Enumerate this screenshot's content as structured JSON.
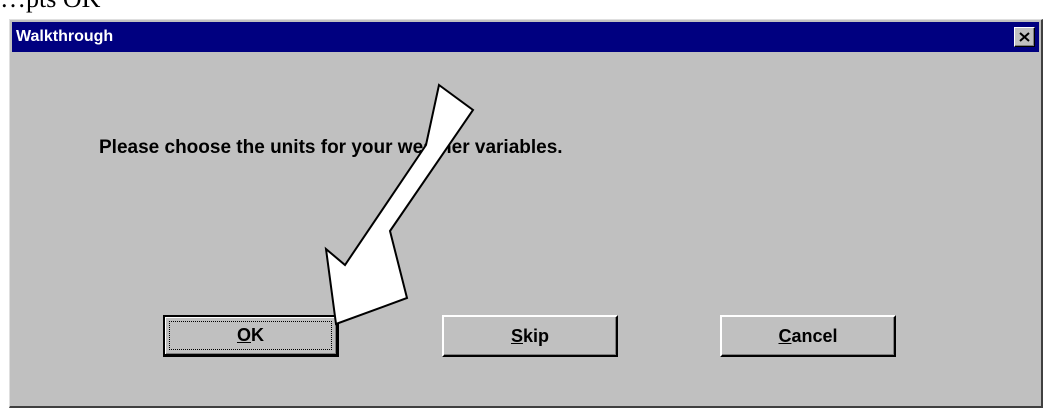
{
  "document": {
    "fragment_text": "…pts OK"
  },
  "dialog": {
    "title": "Walkthrough",
    "close_label": "close",
    "message": "Please choose the units for your weather variables.",
    "buttons": {
      "ok": {
        "mnemonic": "O",
        "rest": "K"
      },
      "skip": {
        "mnemonic": "S",
        "rest": "kip"
      },
      "cancel": {
        "mnemonic": "C",
        "rest": "ancel"
      }
    }
  },
  "annotation": {
    "type": "pointer-arrow",
    "icon": "arrow-icon",
    "target": "ok-button"
  },
  "colors": {
    "titlebar": "#000080",
    "dialog_face": "#c0c0c0",
    "arrow_fill": "#ffffff",
    "arrow_stroke": "#000000"
  }
}
